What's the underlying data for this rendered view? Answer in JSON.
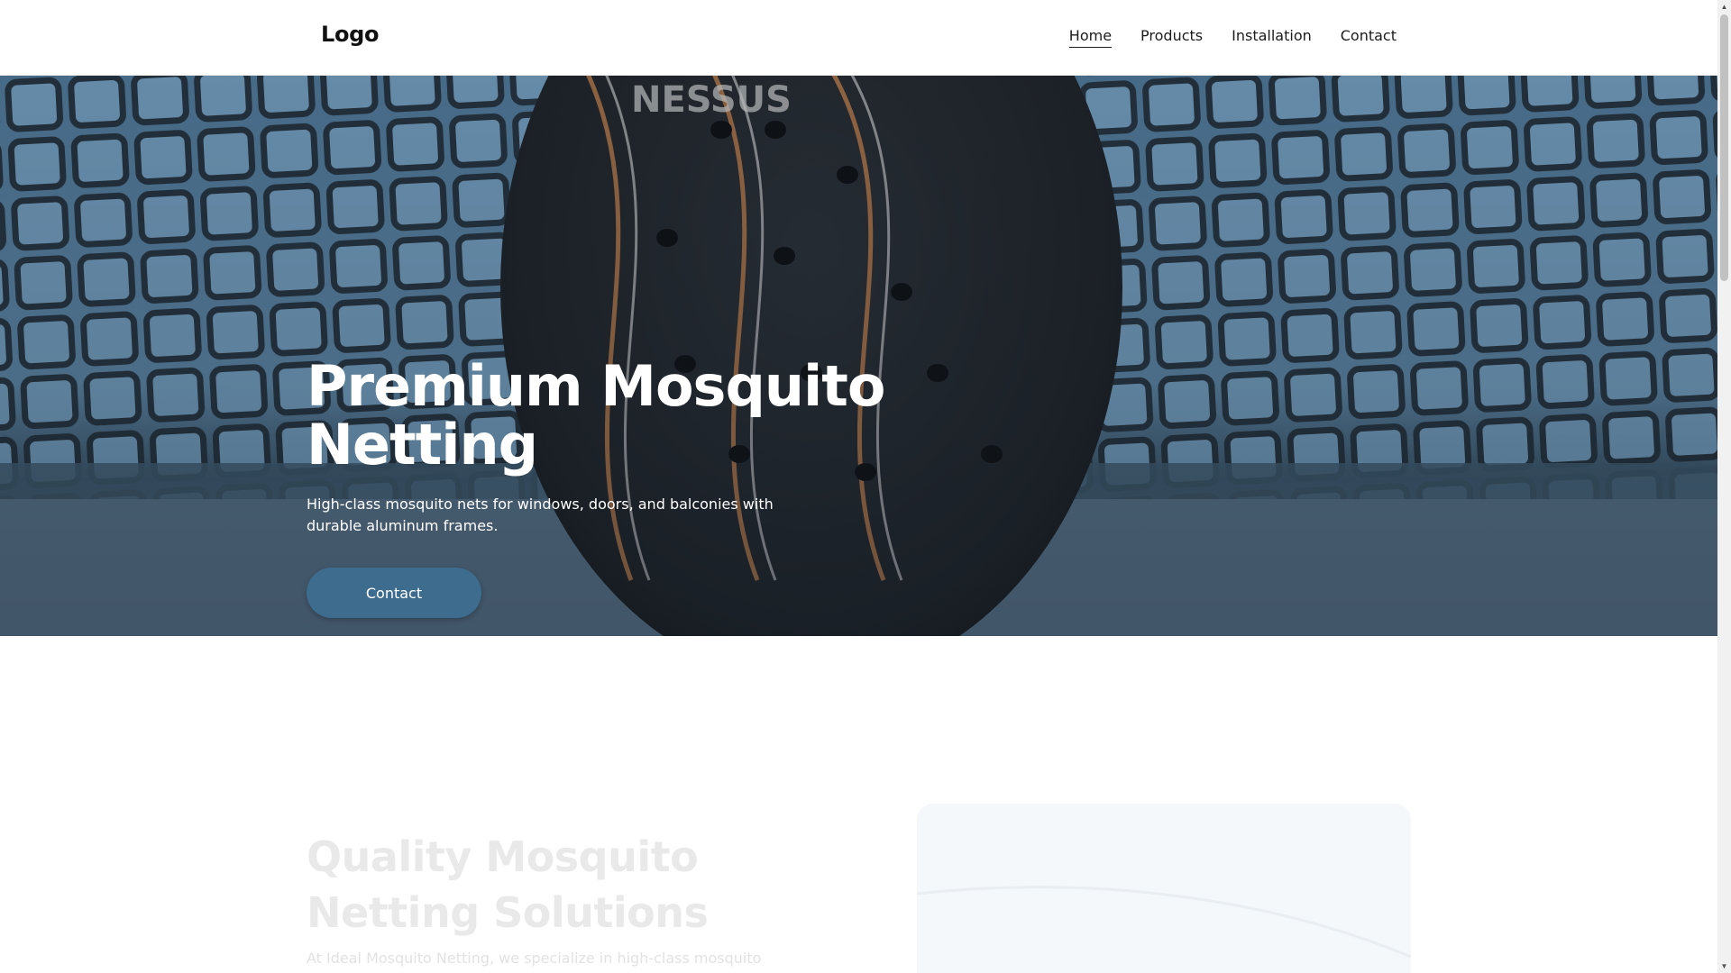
{
  "header": {
    "logo": "Logo",
    "nav": [
      {
        "label": "Home",
        "active": true
      },
      {
        "label": "Products",
        "active": false
      },
      {
        "label": "Installation",
        "active": false
      },
      {
        "label": "Contact",
        "active": false
      }
    ]
  },
  "hero": {
    "title": "Premium Mosquito Netting",
    "subtitle": "High-class mosquito nets for windows, doors, and balconies with durable aluminum frames.",
    "button_label": "Contact",
    "racket_text": "NESSUS"
  },
  "section2": {
    "title": "Quality Mosquito Netting Solutions",
    "text": "At Ideal Mosquito Netting, we specialize in high-class mosquito"
  },
  "colors": {
    "button": "#3e6c8f",
    "hero_overlay": "#3c5e78",
    "faded_text": "#e9e9e9"
  }
}
